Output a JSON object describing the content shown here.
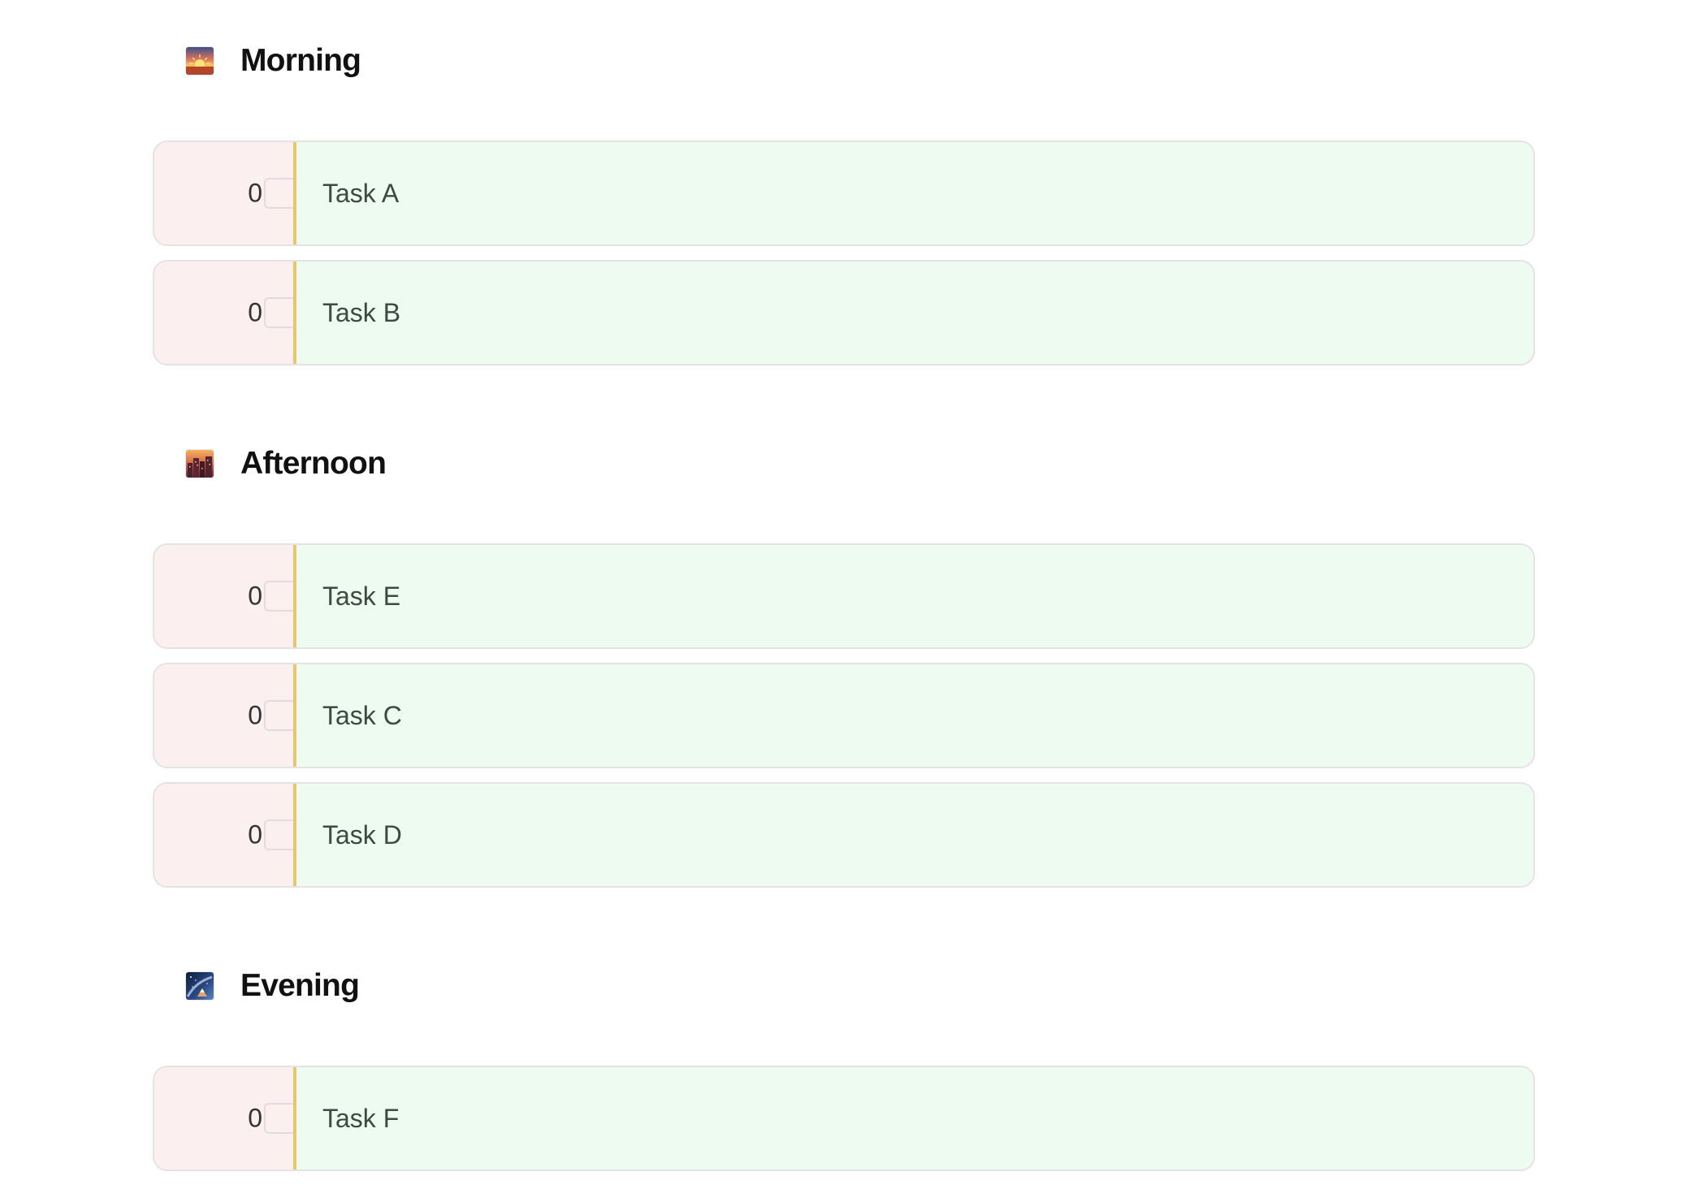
{
  "sections": [
    {
      "title": "Morning",
      "icon": "sunrise-icon",
      "tasks": [
        {
          "count": "0",
          "label": "Task A"
        },
        {
          "count": "0",
          "label": "Task B"
        }
      ]
    },
    {
      "title": "Afternoon",
      "icon": "cityscape-dusk-icon",
      "tasks": [
        {
          "count": "0",
          "label": "Task E"
        },
        {
          "count": "0",
          "label": "Task C"
        },
        {
          "count": "0",
          "label": "Task D"
        }
      ]
    },
    {
      "title": "Evening",
      "icon": "night-stars-icon",
      "tasks": [
        {
          "count": "0",
          "label": "Task F"
        }
      ]
    }
  ],
  "colors": {
    "count_cell_bg": "#fcefef",
    "task_body_bg": "#eefbf1",
    "divider": "#ebc46e",
    "row_border": "#e3e3e3"
  }
}
